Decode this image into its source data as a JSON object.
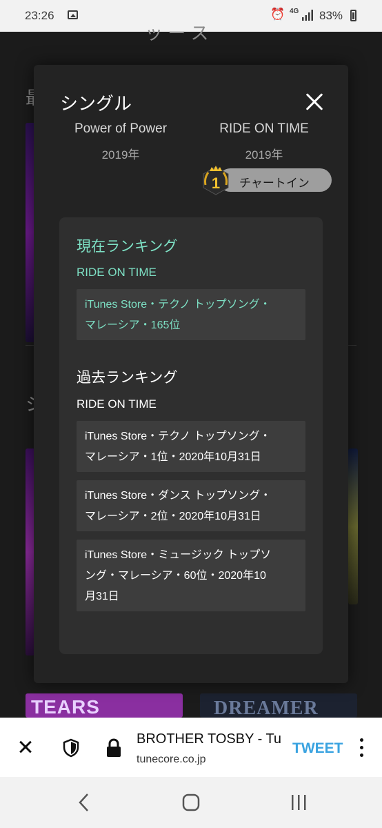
{
  "status_bar": {
    "time": "23:26",
    "network": "4G",
    "battery": "83%"
  },
  "background_page": {
    "thumbnails": [
      {
        "text": "TEARS SQUALL"
      },
      {
        "text": "DREAMER"
      }
    ]
  },
  "modal": {
    "title": "シングル",
    "releases": [
      {
        "title": "Power of Power",
        "year": "2019年"
      },
      {
        "title": "RIDE ON TIME",
        "year": "2019年"
      }
    ],
    "chart_badge": {
      "rank": "1",
      "label": "チャートイン"
    },
    "current_ranking": {
      "title": "現在ランキング",
      "song": "RIDE ON TIME",
      "items": [
        {
          "line1": "iTunes Store・テクノ トップソング・",
          "line2": "マレーシア・165位"
        }
      ]
    },
    "past_ranking": {
      "title": "過去ランキング",
      "song": "RIDE ON TIME",
      "items": [
        {
          "line1": "iTunes Store・テクノ トップソング・",
          "line2": "マレーシア・1位・2020年10月31日"
        },
        {
          "line1": "iTunes Store・ダンス トップソング・",
          "line2": "マレーシア・2位・2020年10月31日"
        },
        {
          "line1": "iTunes Store・ミュージック トップソ",
          "line2": "ング・マレーシア・60位・2020年10",
          "line3": "月31日"
        }
      ]
    }
  },
  "browser_bar": {
    "page_title": "BROTHER TOSBY - Tu",
    "domain": "tunecore.co.jp",
    "tweet_label": "TWEET"
  },
  "colors": {
    "accent_teal": "#7de0c4",
    "tweet_blue": "#3aa3e0",
    "modal_bg": "#232323",
    "panel_bg": "#2f2f2f",
    "item_bg": "#3d3d3d"
  }
}
